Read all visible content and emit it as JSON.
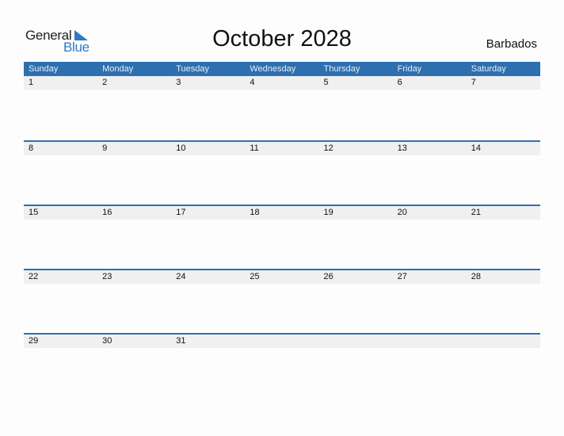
{
  "logo": {
    "word1": "General",
    "word2": "Blue"
  },
  "title": "October 2028",
  "country": "Barbados",
  "colors": {
    "accent": "#2e6fb0",
    "date_band": "#f0f0f0"
  },
  "weekdays": [
    "Sunday",
    "Monday",
    "Tuesday",
    "Wednesday",
    "Thursday",
    "Friday",
    "Saturday"
  ],
  "weeks": [
    [
      "1",
      "2",
      "3",
      "4",
      "5",
      "6",
      "7"
    ],
    [
      "8",
      "9",
      "10",
      "11",
      "12",
      "13",
      "14"
    ],
    [
      "15",
      "16",
      "17",
      "18",
      "19",
      "20",
      "21"
    ],
    [
      "22",
      "23",
      "24",
      "25",
      "26",
      "27",
      "28"
    ],
    [
      "29",
      "30",
      "31",
      "",
      "",
      "",
      ""
    ]
  ]
}
